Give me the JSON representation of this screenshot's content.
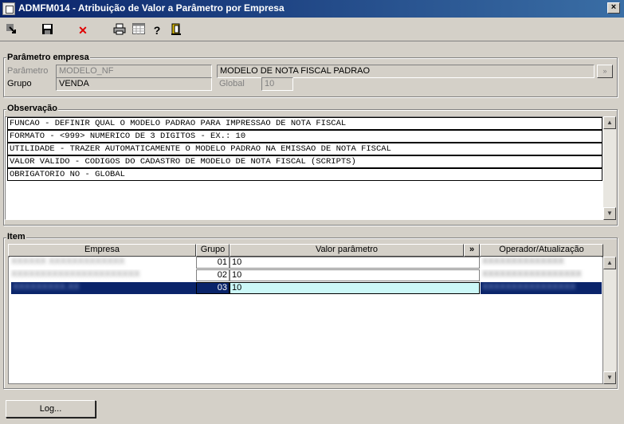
{
  "window": {
    "title": "ADMFM014 - Atribuição de Valor a Parâmetro por Empresa"
  },
  "toolbar": {
    "icons": [
      "exit-arrow-icon",
      "save-icon",
      "delete-x-icon",
      "print-icon",
      "grid-icon",
      "help-icon",
      "door-exit-icon"
    ]
  },
  "param_group": {
    "legend": "Parâmetro empresa",
    "parametro_label": "Parâmetro",
    "parametro_code": "MODELO_NF",
    "parametro_desc": "MODELO DE NOTA FISCAL PADRAO",
    "lookup_label": "»",
    "grupo_label": "Grupo",
    "grupo_value": "VENDA",
    "global_label": "Global",
    "global_value": "10"
  },
  "obs_group": {
    "legend": "Observação",
    "lines": [
      "FUNCAO - DEFINIR QUAL O MODELO PADRAO PARA IMPRESSAO DE NOTA FISCAL",
      "FORMATO - <999> NUMERICO DE 3 DIGITOS - EX.: 10",
      "UTILIDADE - TRAZER AUTOMATICAMENTE O MODELO PADRAO NA EMISSAO DE NOTA FISCAL",
      "VALOR VALIDO - CODIGOS DO CADASTRO DE MODELO DE NOTA FISCAL (SCRIPTS)",
      "OBRIGATORIO NO - GLOBAL"
    ]
  },
  "item_group": {
    "legend": "Item",
    "columns": {
      "empresa": "Empresa",
      "grupo": "Grupo",
      "valor": "Valor parâmetro",
      "expand": "»",
      "operador": "Operador/Atualização"
    },
    "rows": [
      {
        "empresa": "XXXXXX  XXXXXXXXXXXXX",
        "grupo": "01",
        "valor": "10",
        "operador": "XXXXXXXXXXXXXX"
      },
      {
        "empresa": "XXXXXXXXXXXXXXXXXXXXXX",
        "grupo": "02",
        "valor": "10",
        "operador": "XXXXXXXXXXXXXXXXX"
      },
      {
        "empresa": "XXXXXXXXX.XX",
        "grupo": "03",
        "valor": "10",
        "operador": "XXXXXXXXXXXXXXXX"
      }
    ]
  },
  "buttons": {
    "log": "Log..."
  }
}
